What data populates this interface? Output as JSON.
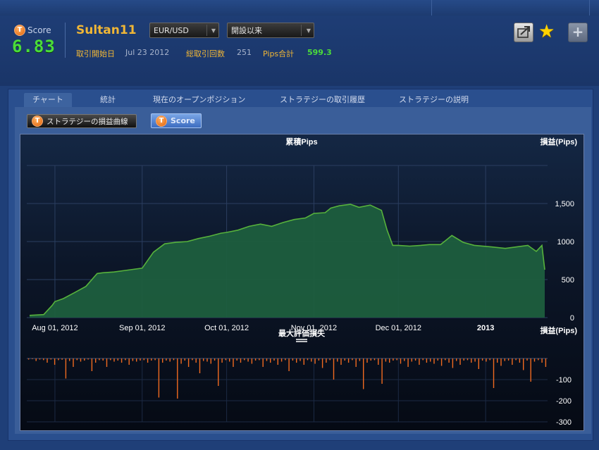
{
  "header": {
    "score_label": "Score",
    "score_value": "6.83",
    "strategy_name": "Sultan11",
    "pair_select": "EUR/USD",
    "period_select": "開設以来",
    "start_label": "取引開始日",
    "start_value": "Jul 23 2012",
    "trades_label": "総取引回数",
    "trades_value": "251",
    "pips_label": "Pips合計",
    "pips_value": "599.3"
  },
  "tabs": [
    {
      "label": "チャート",
      "active": true
    },
    {
      "label": "統計"
    },
    {
      "label": "現在のオープンポジション"
    },
    {
      "label": "ストラテジーの取引履歴"
    },
    {
      "label": "ストラテジーの説明"
    }
  ],
  "buttons": {
    "equity_curve": "ストラテジーの損益曲線",
    "score": "Score"
  },
  "colors": {
    "accent_orange": "#f0b636",
    "score_green": "#4bdc3a",
    "area_fill": "#1d5e3e",
    "area_line": "#57b23c",
    "drawdown_bar": "#f06a20"
  },
  "icons": [
    "share-icon",
    "star-icon",
    "plus-icon",
    "t-badge-icon",
    "chevron-down-icon"
  ],
  "chart_data": [
    {
      "type": "area",
      "title": "累積Pips",
      "ylabel": "損益(Pips)",
      "x_tick_labels": [
        "Aug 01, 2012",
        "Sep 01, 2012",
        "Oct 01, 2012",
        "Nov 01, 2012",
        "Dec 01, 2012",
        "2013"
      ],
      "y_ticks": [
        0,
        500,
        1000,
        "1,500"
      ],
      "ylim": [
        0,
        2000
      ],
      "grid": true,
      "series": [
        {
          "x": [
            "2012-07-23",
            "2012-07-28",
            "2012-07-31",
            "2012-08-01",
            "2012-08-04",
            "2012-08-08",
            "2012-08-12",
            "2012-08-16",
            "2012-08-18",
            "2012-08-22",
            "2012-08-26",
            "2012-09-01",
            "2012-09-05",
            "2012-09-09",
            "2012-09-13",
            "2012-09-17",
            "2012-09-21",
            "2012-09-25",
            "2012-09-29",
            "2012-10-01",
            "2012-10-05",
            "2012-10-09",
            "2012-10-13",
            "2012-10-17",
            "2012-10-21",
            "2012-10-25",
            "2012-10-29",
            "2012-11-01",
            "2012-11-05",
            "2012-11-07",
            "2012-11-10",
            "2012-11-14",
            "2012-11-17",
            "2012-11-21",
            "2012-11-25",
            "2012-11-27",
            "2012-11-29",
            "2012-12-01",
            "2012-12-05",
            "2012-12-09",
            "2012-12-12",
            "2012-12-16",
            "2012-12-20",
            "2012-12-24",
            "2012-12-28",
            "2013-01-03",
            "2013-01-08",
            "2013-01-12",
            "2013-01-16",
            "2013-01-19",
            "2013-01-21",
            "2013-01-22"
          ],
          "y": [
            30,
            40,
            160,
            210,
            250,
            330,
            410,
            580,
            590,
            600,
            620,
            650,
            860,
            970,
            990,
            1000,
            1040,
            1070,
            1110,
            1120,
            1150,
            1200,
            1230,
            1200,
            1250,
            1290,
            1310,
            1370,
            1380,
            1440,
            1470,
            1490,
            1450,
            1480,
            1410,
            1150,
            950,
            950,
            940,
            950,
            960,
            960,
            1080,
            990,
            950,
            930,
            910,
            930,
            950,
            870,
            950,
            630
          ]
        }
      ]
    },
    {
      "type": "bar",
      "title": "最大評価損失",
      "ylabel": "損益(Pips)",
      "y_ticks": [
        -100,
        -200,
        -300
      ],
      "ylim": [
        -300,
        0
      ],
      "series": [
        {
          "values": [
            -5,
            -3,
            -12,
            -5,
            -8,
            -20,
            -5,
            -30,
            -8,
            -6,
            -95,
            -12,
            -40,
            -8,
            -15,
            -10,
            -5,
            -60,
            -20,
            -8,
            -10,
            -40,
            -8,
            -15,
            -10,
            -20,
            -8,
            -30,
            -12,
            -15,
            -10,
            -8,
            -20,
            -10,
            -8,
            -185,
            -20,
            -10,
            -15,
            -8,
            -190,
            -25,
            -10,
            -40,
            -8,
            -20,
            -70,
            -12,
            -15,
            -25,
            -10,
            -130,
            -20,
            -8,
            -15,
            -40,
            -10,
            -20,
            -8,
            -15,
            -25,
            -10,
            -8,
            -40,
            -12,
            -20,
            -10,
            -30,
            -15,
            -8,
            -60,
            -10,
            -20,
            -12,
            -30,
            -8,
            -15,
            -25,
            -10,
            -45,
            -20,
            -8,
            -100,
            -15,
            -30,
            -10,
            -20,
            -8,
            -40,
            -12,
            -145,
            -20,
            -10,
            -8,
            -30,
            -120,
            -15,
            -20,
            -10,
            -8,
            -25,
            -12,
            -40,
            -15,
            -10,
            -30,
            -8,
            -20,
            -15,
            -25,
            -10,
            -35,
            -8,
            -20,
            -45,
            -12,
            -30,
            -10,
            -8,
            -20,
            -15,
            -50,
            -10,
            -15,
            -8,
            -140,
            -20,
            -35,
            -12,
            -10,
            -30,
            -8,
            -20,
            -55,
            -10,
            -110,
            -15,
            -8,
            -20,
            -40
          ]
        }
      ]
    }
  ]
}
